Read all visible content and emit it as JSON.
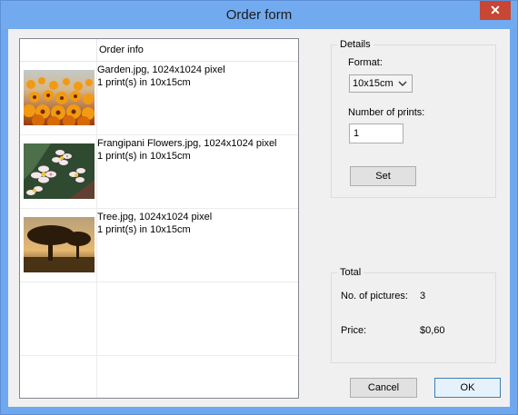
{
  "window": {
    "title": "Order form",
    "close_glyph": "✕"
  },
  "list": {
    "header": "Order info",
    "items": [
      {
        "thumb": "garden-thumbnail",
        "line1": "Garden.jpg, 1024x1024 pixel",
        "line2": "1 print(s) in  10x15cm"
      },
      {
        "thumb": "frangipani-thumbnail",
        "line1": "Frangipani Flowers.jpg, 1024x1024 pixel",
        "line2": "1 print(s) in  10x15cm"
      },
      {
        "thumb": "tree-thumbnail",
        "line1": "Tree.jpg, 1024x1024 pixel",
        "line2": "1 print(s) in  10x15cm"
      }
    ]
  },
  "details": {
    "legend": "Details",
    "format_label": "Format:",
    "format_value": "10x15cm",
    "prints_label": "Number of prints:",
    "prints_value": "1",
    "set_label": "Set"
  },
  "total": {
    "legend": "Total",
    "count_label": "No. of pictures:",
    "count_value": "3",
    "price_label": "Price:",
    "price_value": "$0,60"
  },
  "buttons": {
    "cancel_label": "Cancel",
    "ok_label": "OK"
  }
}
